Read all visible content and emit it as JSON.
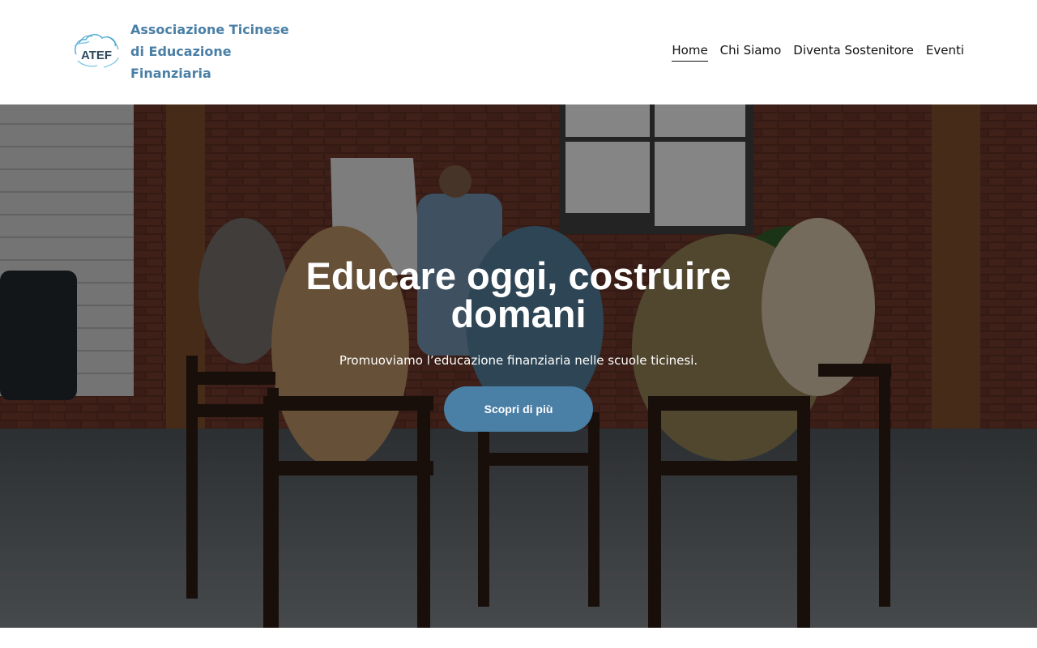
{
  "header": {
    "brand_name": "Associazione Ticinese di Educazione Finanziaria",
    "logo_text": "ATEF",
    "nav": [
      {
        "label": "Home",
        "active": true
      },
      {
        "label": "Chi Siamo",
        "active": false
      },
      {
        "label": "Diventa Sostenitore",
        "active": false
      },
      {
        "label": "Eventi",
        "active": false
      }
    ]
  },
  "hero": {
    "title": "Educare oggi, costruire domani",
    "subtitle": "Promuoviamo l’educazione finanziaria nelle scuole ticinesi.",
    "cta_label": "Scopri di più",
    "image_description_icon": "classroom-photo"
  },
  "colors": {
    "brand": "#4a7fa6",
    "nav_text": "#111111",
    "hero_text": "#ffffff"
  }
}
